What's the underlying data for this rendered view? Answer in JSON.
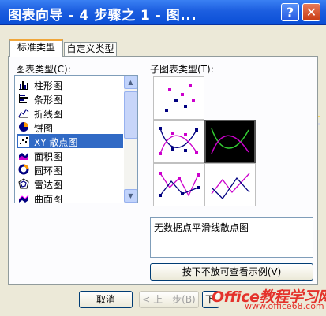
{
  "window": {
    "title": "图表向导 - 4 步骤之 1 - 图...",
    "help_label": "?",
    "close_label": "✕"
  },
  "tabs": [
    {
      "label": "标准类型"
    },
    {
      "label": "自定义类型"
    }
  ],
  "chart_types_label": "图表类型(C):",
  "chart_types": [
    {
      "label": "柱形图",
      "icon": "column-chart-icon"
    },
    {
      "label": "条形图",
      "icon": "bar-chart-icon"
    },
    {
      "label": "折线图",
      "icon": "line-chart-icon"
    },
    {
      "label": "饼图",
      "icon": "pie-chart-icon"
    },
    {
      "label": "XY 散点图",
      "icon": "scatter-chart-icon",
      "selected": true
    },
    {
      "label": "面积图",
      "icon": "area-chart-icon"
    },
    {
      "label": "圆环图",
      "icon": "doughnut-chart-icon"
    },
    {
      "label": "雷达图",
      "icon": "radar-chart-icon"
    },
    {
      "label": "曲面图",
      "icon": "surface-chart-icon"
    }
  ],
  "subtypes_label": "子图表类型(T):",
  "subtypes": [
    {
      "icon": "scatter-markers-icon"
    },
    {
      "icon": "smooth-line-markers-icon"
    },
    {
      "icon": "smooth-line-no-markers-icon",
      "selected": true
    },
    {
      "icon": "straight-line-markers-icon"
    },
    {
      "icon": "straight-line-no-markers-icon"
    }
  ],
  "subtype_description": "无数据点平滑线散点图",
  "preview_button": "按下不放可查看示例(V)",
  "buttons": {
    "cancel": "取消",
    "back": "< 上一步(B)",
    "next": "下一"
  },
  "watermark": {
    "brand": "Office教程学习网",
    "url": "www.office68.com"
  },
  "colors": {
    "titlebar": "#0a4fd6",
    "selection": "#316ac5",
    "marker": "#cc00cc",
    "accent_line": "#33cc33"
  }
}
